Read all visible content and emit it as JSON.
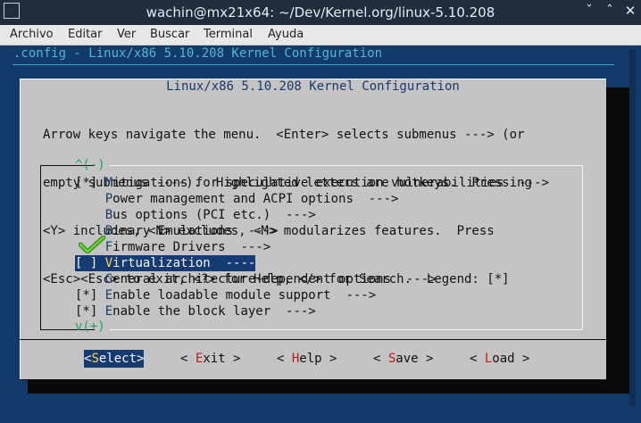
{
  "window": {
    "title": "wachin@mx21x64: ~/Dev/Kernel.org/linux-5.10.208",
    "minimize": "ˇ",
    "maximize": "ˆ",
    "close": "✕"
  },
  "menubar": [
    "Archivo",
    "Editar",
    "Ver",
    "Buscar",
    "Terminal",
    "Ayuda"
  ],
  "terminal": {
    "config_line": ".config - Linux/x86 5.10.208 Kernel Configuration"
  },
  "dialog": {
    "title": "Linux/x86 5.10.208 Kernel Configuration",
    "help": [
      "Arrow keys navigate the menu.  <Enter> selects submenus ---> (or",
      "empty submenus ----).  Highlighted letters are hotkeys.  Pressing",
      "<Y> includes, <N> excludes, <M> modularizes features.  Press",
      "<Esc><Esc> to exit, <?> for Help, </> for Search.  Legend: [*]"
    ],
    "scroll_up": "^(-)",
    "scroll_down": "v(+)",
    "items": [
      {
        "prefix": "[*] ",
        "hotkey": "M",
        "rest": "itigations for speculative execution vulnerabilities  --->",
        "selected": false
      },
      {
        "prefix": "    ",
        "hotkey": "P",
        "rest": "ower management and ACPI options  --->",
        "selected": false
      },
      {
        "prefix": "    ",
        "hotkey": "B",
        "rest": "us options (PCI etc.)  --->",
        "selected": false
      },
      {
        "prefix": "    ",
        "hotkey": "B",
        "rest": "inary Emulations  --->",
        "selected": false
      },
      {
        "prefix": "    ",
        "hotkey": "F",
        "rest": "irmware Drivers  --->",
        "selected": false
      },
      {
        "prefix": "[ ] ",
        "hotkey": "V",
        "rest": "irtualization  ----",
        "selected": true
      },
      {
        "prefix": "    ",
        "hotkey": "G",
        "rest": "eneral architecture-dependent options  --->",
        "selected": false
      },
      {
        "prefix": "[*] ",
        "hotkey": "E",
        "rest": "nable loadable module support  --->",
        "selected": false
      },
      {
        "prefix": "[*] ",
        "hotkey": "E",
        "rest": "nable the block layer  --->",
        "selected": false
      }
    ],
    "buttons": [
      {
        "pre": "<",
        "hotkey": "S",
        "rest": "elect>",
        "selected": true
      },
      {
        "pre": "< ",
        "hotkey": "E",
        "rest": "xit >",
        "selected": false
      },
      {
        "pre": "< ",
        "hotkey": "H",
        "rest": "elp >",
        "selected": false
      },
      {
        "pre": "< ",
        "hotkey": "S",
        "rest": "ave >",
        "selected": false
      },
      {
        "pre": "< ",
        "hotkey": "L",
        "rest": "oad >",
        "selected": false
      }
    ],
    "check_icon": "green-checkmark-icon"
  },
  "colors": {
    "terminal_bg": "#123a6a",
    "dialog_bg": "#c4c4c4",
    "selection_bg": "#163b73",
    "hotkey_menu": "#1a3a6a",
    "hotkey_button": "#b8201a",
    "scroll_indicator": "#20a35a",
    "check": "#3fae1f"
  }
}
